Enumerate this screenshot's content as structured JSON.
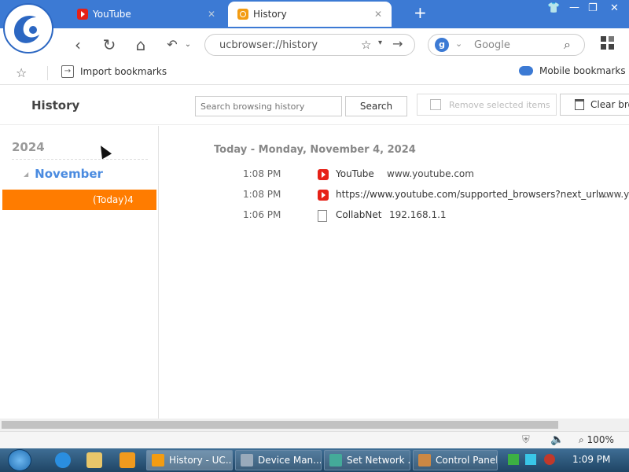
{
  "browser": {
    "tabs": [
      {
        "label": "YouTube",
        "icon": "youtube-icon",
        "active": false
      },
      {
        "label": "History",
        "icon": "history-icon",
        "active": true
      }
    ],
    "address": "ucbrowser://history",
    "search_placeholder": "Google",
    "bookmarks": {
      "import_label": "Import bookmarks",
      "mobile_label": "Mobile bookmarks"
    }
  },
  "history_page": {
    "title": "History",
    "search_placeholder": "Search browsing history",
    "search_button": "Search",
    "remove_button": "Remove selected items",
    "clear_button": "Clear bro",
    "sidebar": {
      "year": "2024",
      "month": "November",
      "day": "(Today)4"
    },
    "day_heading": "Today - Monday, November 4, 2024",
    "entries": [
      {
        "time": "1:08 PM",
        "title": "YouTube",
        "url": "www.youtube.com",
        "icon": "youtube-icon"
      },
      {
        "time": "1:08 PM",
        "title": "https://www.youtube.com/supported_browsers?next_url...",
        "url": "www.y",
        "icon": "youtube-icon"
      },
      {
        "time": "1:06 PM",
        "title": "CollabNet",
        "url": "192.168.1.1",
        "icon": "document-icon"
      }
    ]
  },
  "statusbar": {
    "zoom": "100%"
  },
  "taskbar": {
    "tasks": [
      {
        "label": "History - UC..."
      },
      {
        "label": "Device Man..."
      },
      {
        "label": "Set Network ..."
      },
      {
        "label": "Control Panel"
      }
    ],
    "clock": "1:09 PM"
  },
  "colors": {
    "accent": "#3c7ad4",
    "selected_day": "#ff7c00",
    "month_text": "#4a8be0"
  }
}
